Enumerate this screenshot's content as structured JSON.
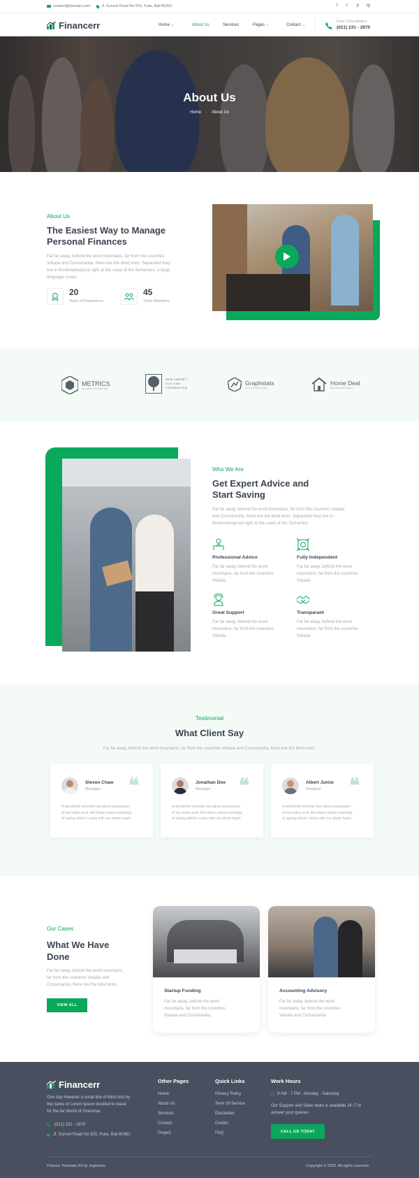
{
  "topbar": {
    "email": "contact@domain.com",
    "address": "Jl. Sunset Road No 815, Kuta, Bali 80361",
    "social": [
      "f",
      "t",
      "p",
      "ig"
    ]
  },
  "header": {
    "brand": "Financerr",
    "nav": [
      "Home",
      "About Us",
      "Services",
      "Pages",
      "Contact"
    ],
    "consult_label": "Free Consultation",
    "consult_phone": "(021) 231 - 2870"
  },
  "hero": {
    "title": "About Us",
    "crumb_home": "Home",
    "crumb_current": "About Us"
  },
  "about": {
    "label": "About Us",
    "title_l1": "The Easiest Way to Manage",
    "title_l2": "Personal Finances",
    "text_l1": "Far far away, behind the word mountains, far from the countries",
    "text_l2": "Vokalia and Consonantia, there live the blind texts. Separated they",
    "text_l3": "live in Bookmarksgrove right at the coast of the Semantics, a large",
    "text_l4": "language ocean.",
    "stat1_value": "20",
    "stat1_label": "Years of Experience",
    "stat2_value": "45",
    "stat2_label": "Team Members"
  },
  "partners": {
    "metrics": "METRICS",
    "metrics_sub": "BUSINESS TAGLINE HERE",
    "oak_l1": "NEW JERSEY",
    "oak_l2": "OLD OAK",
    "oak_l3": "FOUNDATION",
    "graphstats": "Graphstats",
    "graphstats_sub": "TAGLINE GOES HERE",
    "homedeal": "Home Deal",
    "homedeal_sub": "REAL ESTATE AGENCY"
  },
  "who": {
    "label": "Who We Are",
    "title_l1": "Get Expert Advice and",
    "title_l2": "Start Saving",
    "text_l1": "Far far away, behind the word mountains, far from the countries Vokalia",
    "text_l2": "and Consonantia, there live the blind texts. Separated they live in",
    "text_l3": "Bookmarksgrove right at the coast of the Semantics",
    "features": [
      {
        "title": "Professional Advice",
        "l1": "Far far away, behind the word",
        "l2": "mountains, far from the countries",
        "l3": "Vokalia"
      },
      {
        "title": "Fully Independent",
        "l1": "Far far away, behind the word",
        "l2": "mountains, far from the countries",
        "l3": "Vokalia"
      },
      {
        "title": "Great Support",
        "l1": "Far far away, behind the word",
        "l2": "mountains, far from the countries",
        "l3": "Vokalia"
      },
      {
        "title": "Transparant",
        "l1": "Far far away, behind the word",
        "l2": "mountains, far from the countries",
        "l3": "Vokalia"
      }
    ]
  },
  "testimonial": {
    "label": "Testimonial",
    "title": "What Client Say",
    "text": "Far far away, behind the word mountains, far from the countries Vokalia and Consonantia, there live the blind texts.",
    "cards": [
      {
        "name": "Steven Chaw",
        "role": "Manager",
        "l1": "A wonderful serenity has taken possession",
        "l2": "of my entire soul, like these sweet mornings",
        "l3": "of spring which I enjoy with my whole heart."
      },
      {
        "name": "Jonathan Doe",
        "role": "Manager",
        "l1": "A wonderful serenity has taken possession",
        "l2": "of my entire soul, like these sweet mornings",
        "l3": "of spring which I enjoy with my whole heart."
      },
      {
        "name": "Albert Junior",
        "role": "Designer",
        "l1": "A wonderful serenity has taken possession",
        "l2": "of my entire soul, like these sweet mornings",
        "l3": "of spring which I enjoy with my whole heart."
      }
    ]
  },
  "cases": {
    "label": "Our Cases",
    "title_l1": "What We Have",
    "title_l2": "Done",
    "text_l1": "Far far away, behind the word mountains,",
    "text_l2": "far from the countries Vokalia and",
    "text_l3": "Consonantia, there live the blind texts.",
    "button": "VIEW ALL",
    "items": [
      {
        "title": "Startup Funding",
        "l1": "Far far away, behind the word",
        "l2": "mountains, far from the countries",
        "l3": "Vokalia and Consonantia"
      },
      {
        "title": "Accounting Advisory",
        "l1": "Far far away, behind the word",
        "l2": "mountains, far from the countries",
        "l3": "Vokalia and Consonantia"
      }
    ]
  },
  "footer": {
    "brand": "Financerr",
    "about_l1": "One day however a small line of blind text by",
    "about_l2": "the name of Lorem Ipsum decided to leave",
    "about_l3": "for the far World of Grammar.",
    "phone": "(021) 231 - 2870",
    "address": "Jl. Sunset Road No 815, Kuta, Bali 80361",
    "other_title": "Other Pages",
    "other_links": [
      "Home",
      "About Us",
      "Services",
      "Contact",
      "Project"
    ],
    "quick_title": "Quick Links",
    "quick_links": [
      "Privacy Policy",
      "Term Of Service",
      "Disclaimer",
      "Credits",
      "FAQ"
    ],
    "work_title": "Work Hours",
    "hours": "8 AM - 7 PM , Monday - Saturday",
    "support_l1": "Our Support and Sales team is available 24 /7 to",
    "support_l2": "answer your queries",
    "call_button": "CALL US TODAY",
    "credit": "Finance Template Kit by Jegtheme",
    "copyright": "Copyright © 2020. All rights reserved."
  },
  "colors": {
    "accent": "#0aa85b",
    "footer_bg": "#485060",
    "tint_bg": "#f4fbf7"
  }
}
